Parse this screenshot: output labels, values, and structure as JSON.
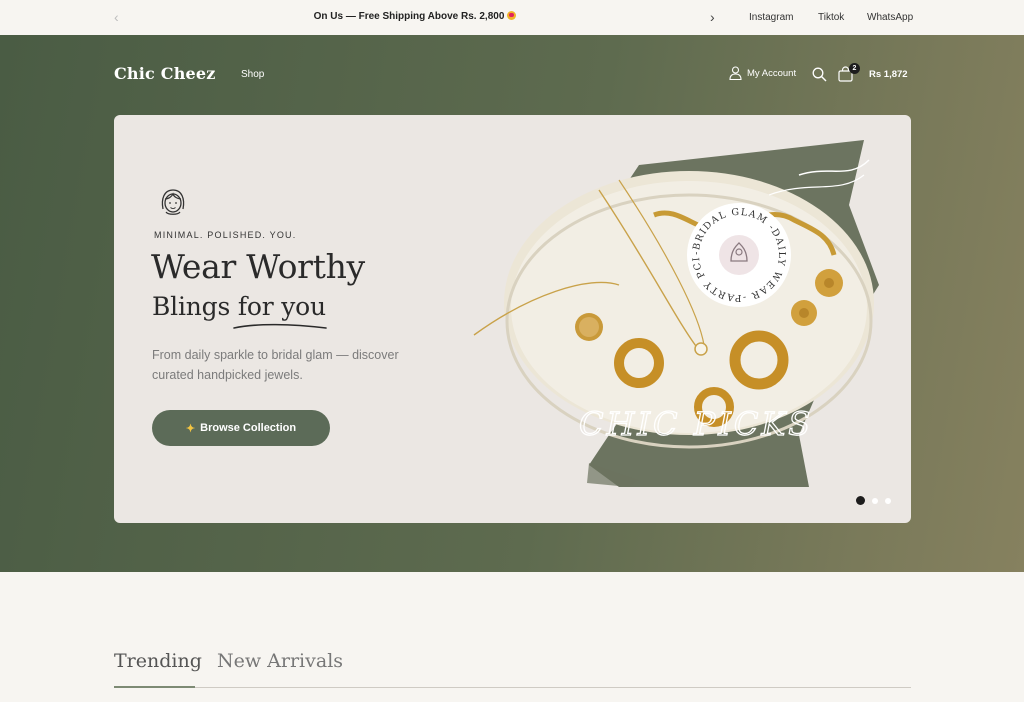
{
  "announcement": {
    "text": "On Us — Free Shipping Above Rs. 2,800",
    "prev_icon": "chevron-left-icon",
    "next_icon": "chevron-right-icon",
    "social_links": [
      "Instagram",
      "Tiktok",
      "WhatsApp"
    ]
  },
  "header": {
    "logo": "Chic Cheez",
    "nav": [
      "Shop"
    ],
    "account_label": "My Account",
    "cart_count": "2",
    "cart_total": "Rs 1,872"
  },
  "hero": {
    "tagline": "MINIMAL. POLISHED. YOU.",
    "heading_line1": "Wear Worthy",
    "heading_line2": "Blings for you",
    "description": "From daily sparkle to bridal glam — discover curated handpicked jewels.",
    "cta_label": "Browse Collection",
    "badge_text": "-BRIDAL GLAM -DAILY WEAR -PARTY PCIKS",
    "overlay_text": "CHIC PICKS",
    "slides": 3,
    "active_slide": 1
  },
  "tabs": {
    "items": [
      "Trending",
      "New Arrivals"
    ],
    "active": "Trending"
  },
  "colors": {
    "band_start": "#4a5c44",
    "band_end": "#86815f",
    "cta": "#5c6b58",
    "hero_card": "#ebe7e3",
    "page_bg": "#f7f5f1"
  }
}
